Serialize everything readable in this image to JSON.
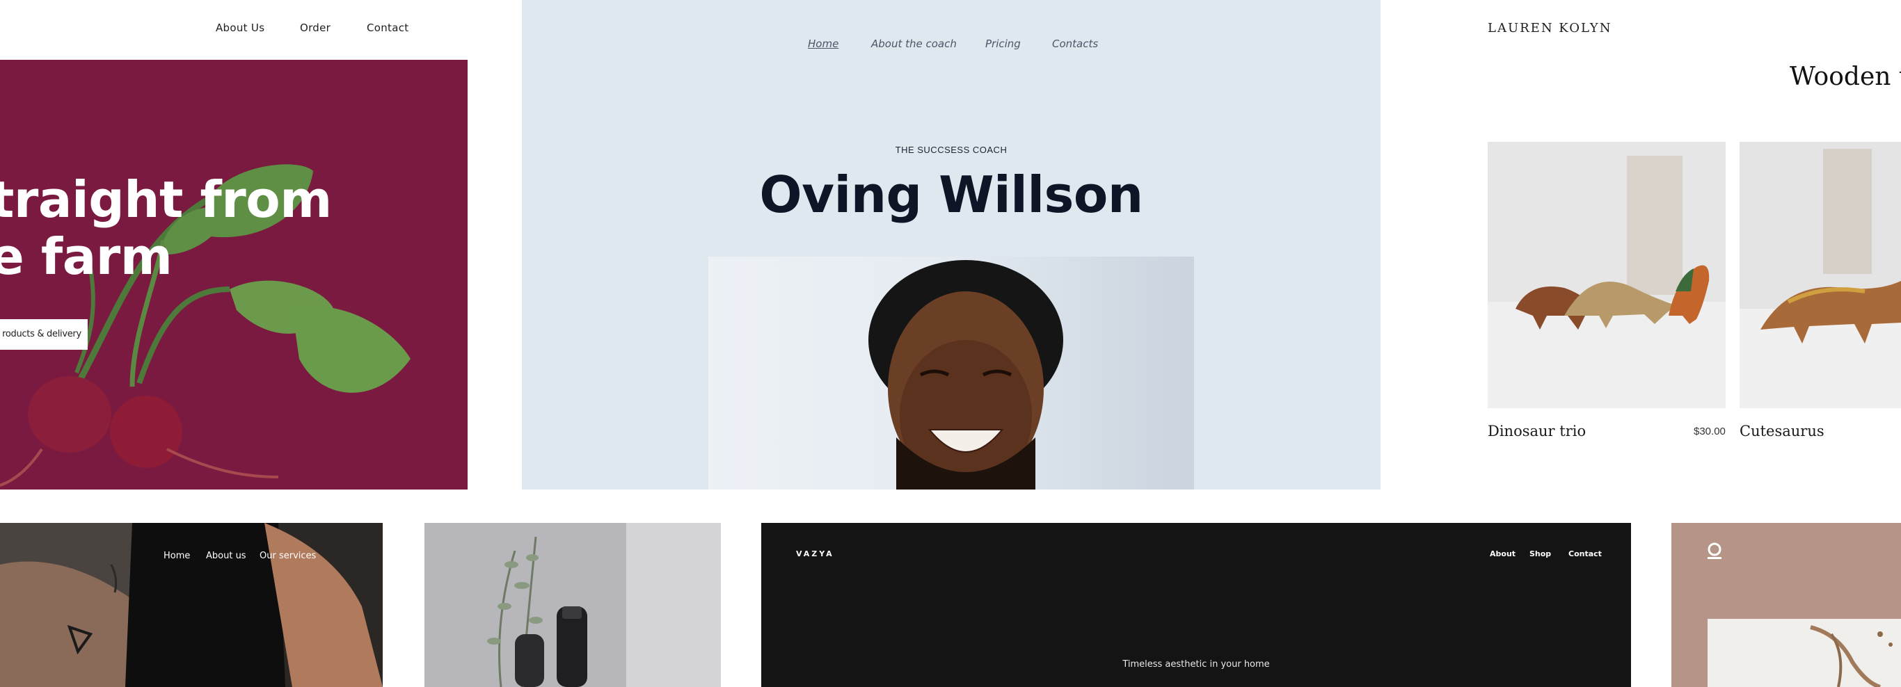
{
  "farm": {
    "nav": [
      "About Us",
      "Order",
      "Contact"
    ],
    "headline": "traight from\ne farm",
    "button_label": "roducts & delivery"
  },
  "coach": {
    "nav": [
      "Home",
      "About the coach",
      "Pricing",
      "Contacts"
    ],
    "eyebrow": "THE SUCCSESS COACH",
    "name": "Oving Willson"
  },
  "toys": {
    "brand": "LAUREN KOLYN",
    "title": "Wooden to",
    "products": [
      {
        "name": "Dinosaur trio",
        "price": "$30.00"
      },
      {
        "name": "Cutesaurus",
        "price": ""
      }
    ]
  },
  "fitness": {
    "nav": [
      "Home",
      "About us",
      "Our services"
    ]
  },
  "vazya": {
    "logo": "VAZYA",
    "nav": [
      "About",
      "Shop",
      "Contact"
    ],
    "tagline": "Timeless aesthetic in your home"
  },
  "colors": {
    "farm_bg": "#7a1a40",
    "coach_bg": "#dfe8ef",
    "vazya_bg": "#141414",
    "mauve_bg": "#b69487"
  }
}
